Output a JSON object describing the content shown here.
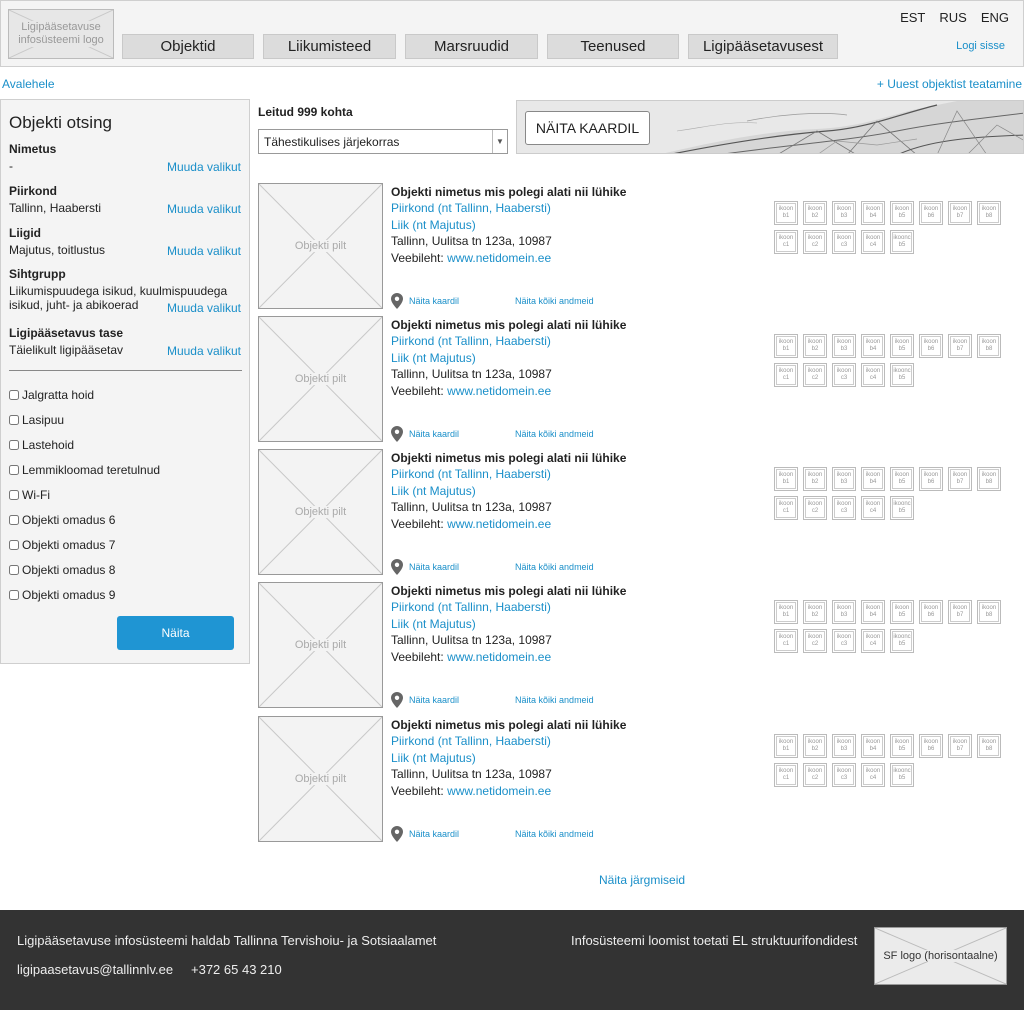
{
  "header": {
    "logo_text": "Ligipääsetavuse infosüsteemi logo",
    "nav": [
      {
        "label": "Objektid"
      },
      {
        "label": "Liikumisteed"
      },
      {
        "label": "Marsruudid"
      },
      {
        "label": "Teenused"
      },
      {
        "label": "Ligipääsetavusest"
      }
    ],
    "languages": [
      "EST",
      "RUS",
      "ENG"
    ],
    "login": "Logi sisse"
  },
  "breadcrumb": "Avalehele",
  "report_link": "+ Uuest objektist teatamine",
  "sidebar": {
    "title": "Objekti otsing",
    "change_label": "Muuda valikut",
    "filters": [
      {
        "label": "Nimetus",
        "value": "-"
      },
      {
        "label": "Piirkond",
        "value": "Tallinn, Haabersti"
      },
      {
        "label": "Liigid",
        "value": "Majutus, toitlustus"
      },
      {
        "label": "Sihtgrupp",
        "value": "Liikumispuudega isikud, kuulmispuudega isikud, juht- ja abikoerad"
      },
      {
        "label": "Ligipääsetavus tase",
        "value": "Täielikult ligipääsetav"
      }
    ],
    "checkboxes": [
      "Jalgratta hoid",
      "Lasipuu",
      "Lastehoid",
      "Lemmikloomad teretulnud",
      "Wi-Fi",
      "Objekti omadus 6",
      "Objekti  omadus 7",
      "Objekti  omadus 8",
      "Objekti  omadus 9"
    ],
    "submit": "Näita"
  },
  "results_header": {
    "found": "Leitud 999 kohta",
    "sort_value": "Tähestikulises järjekorras",
    "map_button": "NÄITA KAARDIL"
  },
  "result_template": {
    "image_label": "Objekti pilt",
    "title": "Objekti nimetus mis polegi alati nii lühike",
    "region": "Piirkond (nt Tallinn, Haabersti)",
    "type": "Liik (nt Majutus)",
    "address": "Tallinn, Uulitsa tn 123a, 10987",
    "website_label": "Veebileht:",
    "website": "www.netidomein.ee",
    "show_on_map": "Näita kaardil",
    "show_all": "Näita kõiki andmeid",
    "icons_row1": [
      [
        "ikoon",
        "b1"
      ],
      [
        "ikoon",
        "b2"
      ],
      [
        "ikoon",
        "b3"
      ],
      [
        "ikoon",
        "b4"
      ],
      [
        "ikoon",
        "b5"
      ],
      [
        "ikoon",
        "b6"
      ],
      [
        "ikoon",
        "b7"
      ],
      [
        "ikoon",
        "b8"
      ]
    ],
    "icons_row2": [
      [
        "ikoon",
        "c1"
      ],
      [
        "ikoon",
        "c2"
      ],
      [
        "ikoon",
        "c3"
      ],
      [
        "ikoon",
        "c4"
      ],
      [
        "ikoonc",
        "b5"
      ]
    ]
  },
  "results_count_shown": 5,
  "next_link": "Näita järgmiseid",
  "footer": {
    "maintainer": "Ligipääsetavuse infosüsteemi haldab Tallinna Tervishoiu- ja Sotsiaalamet",
    "email": "ligipaasetavus@tallinnlv.ee",
    "phone": "+372 65 43 210",
    "funding": "Infosüsteemi loomist toetati EL struktuurifondidest",
    "sf_logo": "SF logo (horisontaalne)"
  }
}
